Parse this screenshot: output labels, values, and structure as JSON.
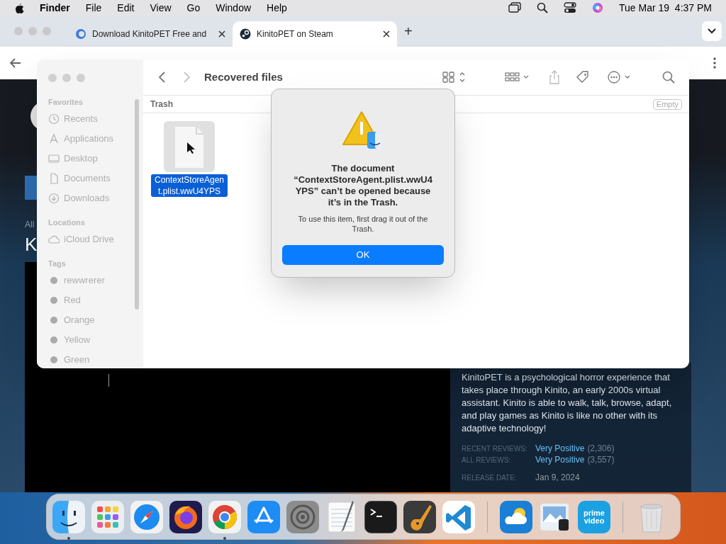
{
  "menu_bar": {
    "app": "Finder",
    "menus": [
      "File",
      "Edit",
      "View",
      "Go",
      "Window",
      "Help"
    ],
    "clock": "Tue Mar 19  4:37 PM"
  },
  "browser": {
    "tabs": [
      {
        "title": "Download KinitoPET Free and",
        "selected": false,
        "kind": "download"
      },
      {
        "title": "KinitoPET on Steam",
        "selected": true,
        "kind": "steam"
      }
    ],
    "new_tab": "+"
  },
  "steam": {
    "breadcrumb": "All",
    "title": "K",
    "description": "KinitoPET is a psychological horror experience that takes place through Kinito, an early 2000s virtual assistant. Kinito is able to walk, talk, browse, adapt, and play games as Kinito is like no other with its adaptive technology!",
    "reviews": [
      {
        "label": "RECENT REVIEWS:",
        "value": "Very Positive",
        "count": "(2,306)"
      },
      {
        "label": "ALL REVIEWS:",
        "value": "Very Positive",
        "count": "(3,557)"
      }
    ],
    "release": {
      "label": "RELEASE DATE:",
      "value": "Jan 9, 2024"
    }
  },
  "finder": {
    "title": "Recovered files",
    "path": "Trash",
    "empty_button": "Empty",
    "sidebar": [
      {
        "heading": "Favorites",
        "items": [
          {
            "label": "Recents",
            "kind": "clock"
          },
          {
            "label": "Applications",
            "kind": "apps"
          },
          {
            "label": "Desktop",
            "kind": "desktop"
          },
          {
            "label": "Documents",
            "kind": "doc"
          },
          {
            "label": "Downloads",
            "kind": "download"
          }
        ]
      },
      {
        "heading": "Locations",
        "items": [
          {
            "label": "iCloud Drive",
            "kind": "cloud"
          }
        ]
      },
      {
        "heading": "Tags",
        "items": [
          {
            "label": "rewwrerer",
            "kind": "tag"
          },
          {
            "label": "Red",
            "kind": "tag"
          },
          {
            "label": "Orange",
            "kind": "tag"
          },
          {
            "label": "Yellow",
            "kind": "tag"
          },
          {
            "label": "Green",
            "kind": "tag"
          }
        ]
      }
    ],
    "files": [
      {
        "name": "ContextStoreAgent.plist.wwU4YPS",
        "selected": true
      }
    ]
  },
  "dialog": {
    "title": "The document “ContextStoreAgent.plist.wwU4YPS” can’t be opened because it’s in the Trash.",
    "message": "To use this item, first drag it out of the Trash.",
    "button": "OK"
  },
  "dock": [
    {
      "kind": "finder",
      "running": true
    },
    {
      "kind": "launchpad",
      "running": false
    },
    {
      "kind": "safari",
      "running": false
    },
    {
      "kind": "firefox",
      "running": false
    },
    {
      "kind": "chrome",
      "running": true
    },
    {
      "kind": "appstore",
      "running": false
    },
    {
      "kind": "settings",
      "running": false
    },
    {
      "kind": "textedit",
      "running": false
    },
    {
      "kind": "terminal",
      "running": false
    },
    {
      "kind": "guitar",
      "running": false
    },
    {
      "kind": "vscode",
      "running": false
    },
    {
      "kind": "separator"
    },
    {
      "kind": "weather",
      "running": false
    },
    {
      "kind": "preview",
      "running": false
    },
    {
      "kind": "video",
      "running": false,
      "text": "prime video"
    },
    {
      "kind": "separator"
    },
    {
      "kind": "trash",
      "running": false
    }
  ]
}
